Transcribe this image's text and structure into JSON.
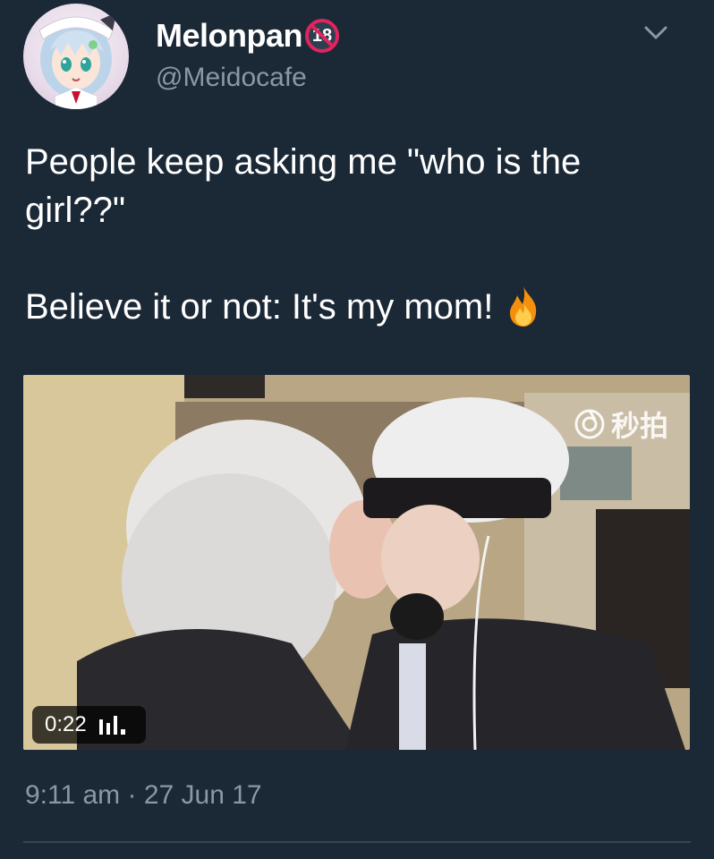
{
  "author": {
    "display_name": "Melonpan",
    "age_badge": "18",
    "handle": "@Meidocafe",
    "avatar_icon": "anime-maid-avatar"
  },
  "menu": {
    "icon": "chevron-down-icon"
  },
  "tweet": {
    "line_1": "People keep asking me \"who is the girl??\"",
    "line_2": "Believe it or not: It's my mom!",
    "emoji": "fire-icon"
  },
  "video": {
    "watermark_text": "秒拍",
    "duration": "0:22",
    "volume_icon": "volume-bars-icon"
  },
  "timestamp": "9:11 am · 27 Jun 17",
  "colors": {
    "background": "#1b2836",
    "secondary_text": "#8899a6",
    "badge_red": "#e0245e"
  }
}
